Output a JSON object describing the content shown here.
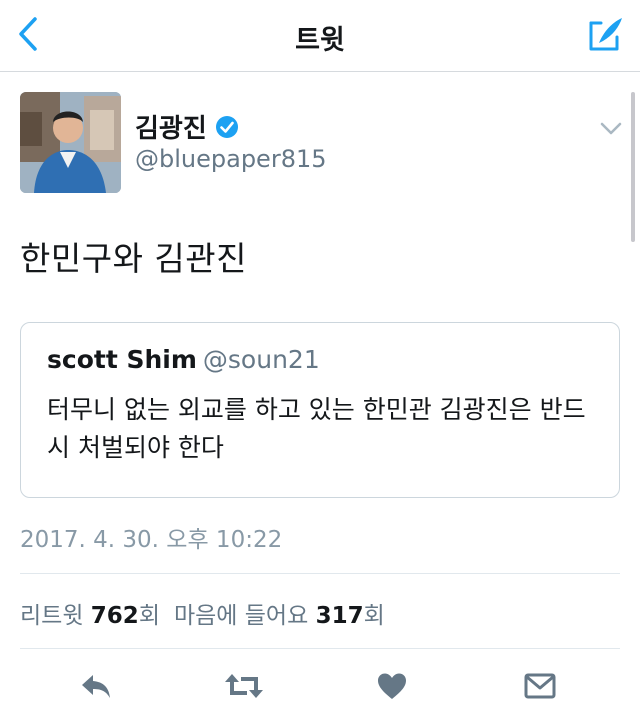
{
  "nav": {
    "title": "트윗",
    "back_icon": "chevron-left-icon",
    "compose_icon": "compose-tweet-icon"
  },
  "tweet": {
    "author_name": "김광진",
    "author_handle": "@bluepaper815",
    "verified": true,
    "text": "한민구와 김관진",
    "timestamp": "2017. 4. 30. 오후 10:22"
  },
  "quoted_tweet": {
    "author_name": "scott Shim",
    "author_handle": "@soun21",
    "text": "터무니 없는 외교를 하고 있는 한민관 김광진은 반드시 처벌되야 한다"
  },
  "stats": {
    "retweets_label": "리트윗",
    "retweets_count": "762",
    "retweets_unit": "회",
    "likes_label": "마음에 들어요",
    "likes_count": "317",
    "likes_unit": "회"
  },
  "actions": [
    "reply-icon",
    "retweet-icon",
    "like-icon",
    "direct-message-icon"
  ],
  "colors": {
    "accent": "#1da1f2",
    "text_primary": "#14171a",
    "text_secondary": "#657786",
    "action_icon": "#657786",
    "border": "#ccd6dd"
  }
}
